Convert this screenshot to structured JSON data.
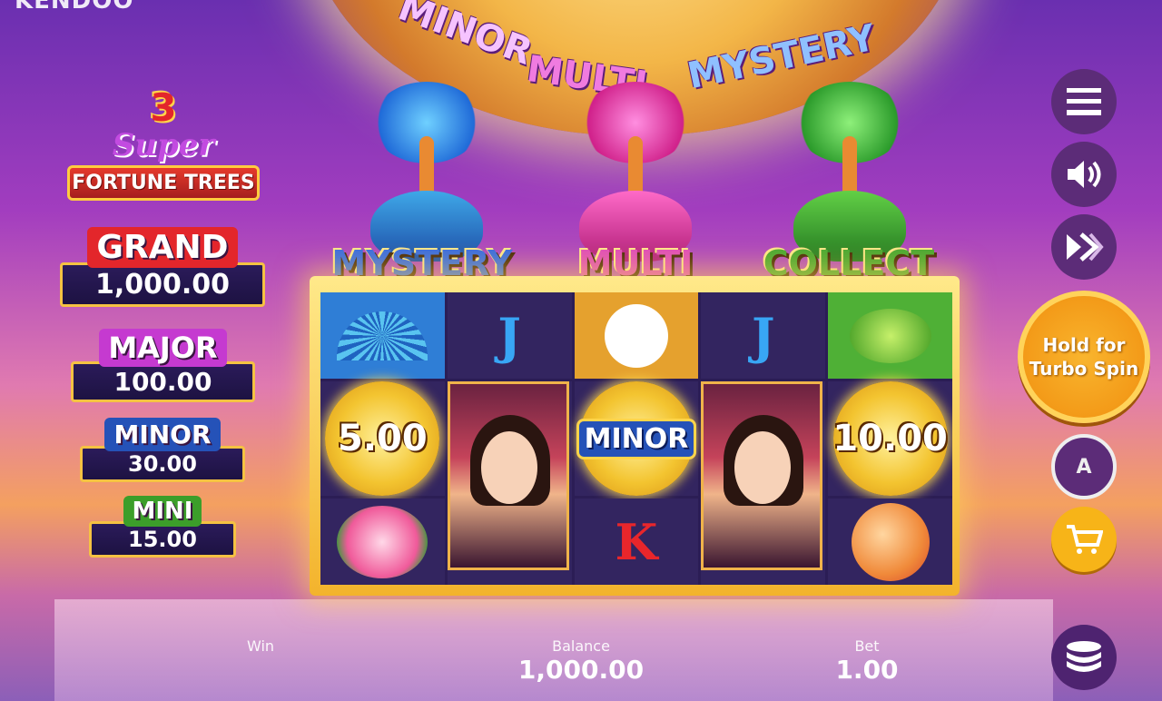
{
  "brand": "KENDOO",
  "wheel_segments": [
    "MINOR",
    "MULTI",
    "MYSTERY"
  ],
  "logo": {
    "number": "3",
    "super": "Super",
    "title": "FORTUNE TREES"
  },
  "jackpots": [
    {
      "label": "GRAND",
      "value": "1,000.00",
      "color": "#e3262b"
    },
    {
      "label": "MAJOR",
      "value": "100.00",
      "color": "#c53ad0"
    },
    {
      "label": "MINOR",
      "value": "30.00",
      "color": "#2552b8"
    },
    {
      "label": "MINI",
      "value": "15.00",
      "color": "#3c9e2a"
    }
  ],
  "features": [
    {
      "label": "MYSTERY",
      "color": "#3a6de0",
      "tree": "blue"
    },
    {
      "label": "MULTI",
      "color": "#e04fb8",
      "tree": "pink"
    },
    {
      "label": "COLLECT",
      "color": "#4aa832",
      "tree": "green"
    }
  ],
  "reels": {
    "row1": [
      "fan-icon",
      "J",
      "crane-icon",
      "J",
      "teapot-icon"
    ],
    "coin1": "5.00",
    "coin2": "MINOR",
    "coin3": "10.00",
    "row3": [
      "lotus-icon",
      "K",
      "peach-icon"
    ]
  },
  "controls": {
    "spin_label_1": "Hold for",
    "spin_label_2": "Turbo Spin",
    "auto_label": "A"
  },
  "footer": {
    "win_label": "Win",
    "balance_label": "Balance",
    "balance_value": "1,000.00",
    "bet_label": "Bet",
    "bet_value": "1.00"
  }
}
